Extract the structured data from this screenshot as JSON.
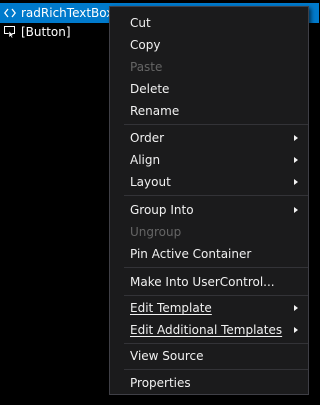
{
  "tree": {
    "selected_item": {
      "icon": "code-brackets-icon",
      "label": "radRichTextBox"
    },
    "child_item": {
      "icon": "button-control-icon",
      "label": "[Button]"
    }
  },
  "context_menu": {
    "items": [
      {
        "label": "Cut",
        "enabled": true
      },
      {
        "label": "Copy",
        "enabled": true
      },
      {
        "label": "Paste",
        "enabled": false
      },
      {
        "label": "Delete",
        "enabled": true
      },
      {
        "label": "Rename",
        "enabled": true
      },
      {
        "label": "Order",
        "enabled": true,
        "submenu": true
      },
      {
        "label": "Align",
        "enabled": true,
        "submenu": true
      },
      {
        "label": "Layout",
        "enabled": true,
        "submenu": true
      },
      {
        "label": "Group Into",
        "enabled": true,
        "submenu": true
      },
      {
        "label": "Ungroup",
        "enabled": false
      },
      {
        "label": "Pin Active Container",
        "enabled": true
      },
      {
        "label": "Make Into UserControl...",
        "enabled": true
      },
      {
        "label": "Edit Template",
        "enabled": true,
        "submenu": true,
        "access_key": "E"
      },
      {
        "label": "Edit Additional Templates",
        "enabled": true,
        "submenu": true,
        "access_key": "E"
      },
      {
        "label": "View Source",
        "enabled": true
      },
      {
        "label": "Properties",
        "enabled": true
      }
    ]
  },
  "colors": {
    "background": "#000000",
    "selection": "#007acc",
    "menu_background": "#1b1b1c",
    "menu_border": "#3f3f46",
    "menu_text": "#f1f1f1",
    "disabled_text": "#656565",
    "separator": "#333337"
  }
}
